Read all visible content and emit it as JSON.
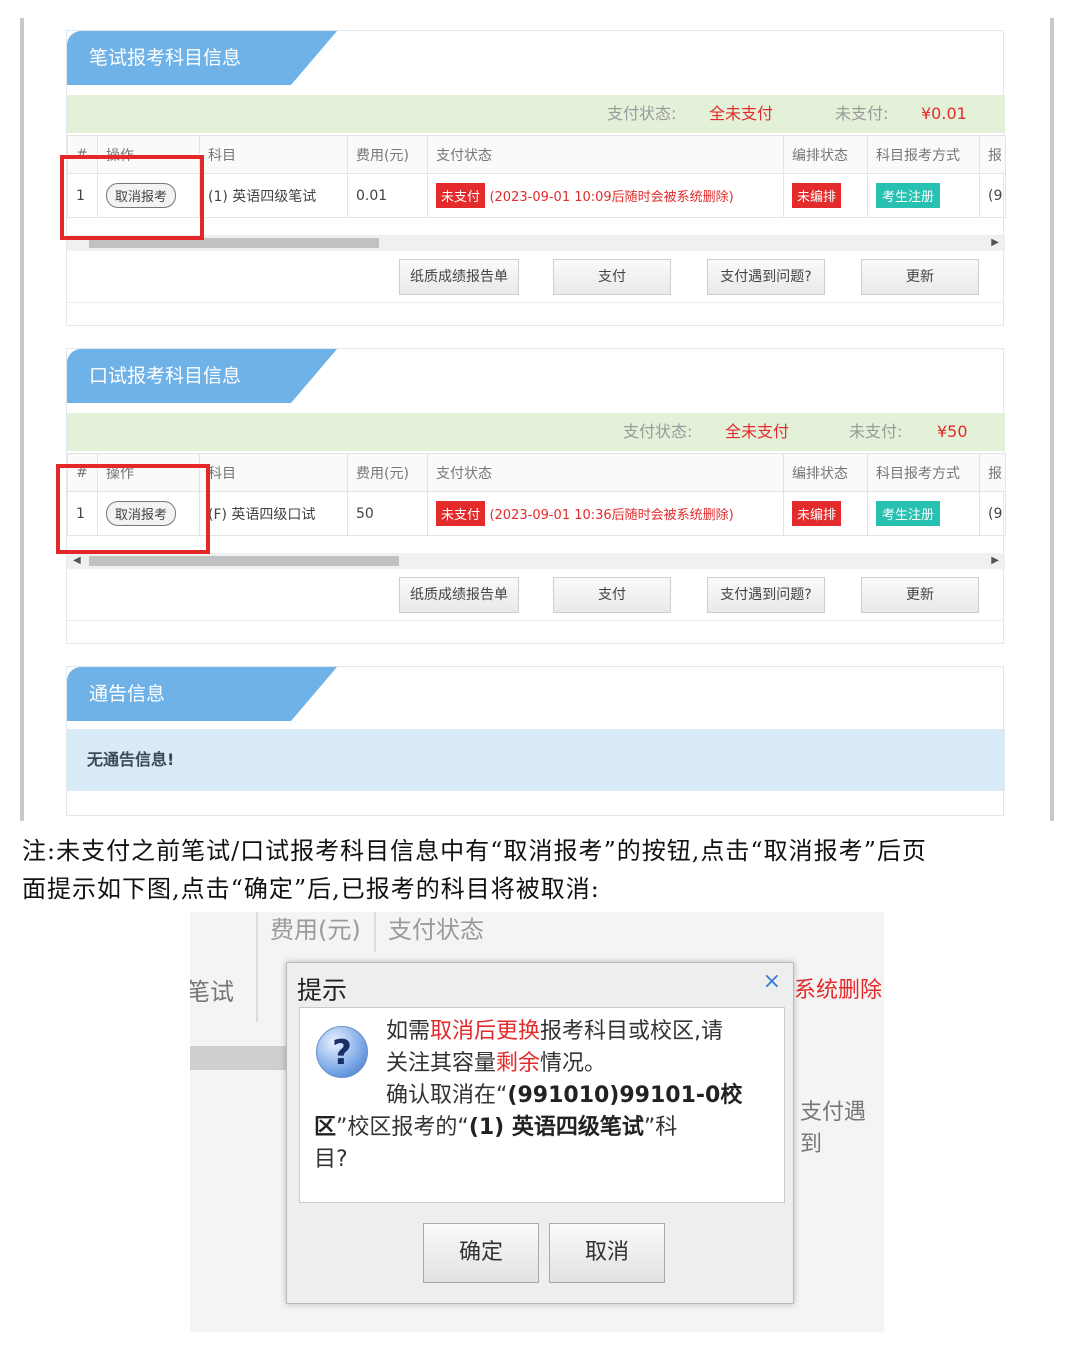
{
  "written_panel": {
    "title": "笔试报考科目信息",
    "status_label": "支付状态:",
    "status_value": "全未支付",
    "unpaid_label": "未支付:",
    "unpaid_value": "¥0.01",
    "headers": [
      "#",
      "操作",
      "科目",
      "费用(元)",
      "支付状态",
      "编排状态",
      "科目报考方式",
      "报"
    ],
    "row": {
      "index": "1",
      "action": "取消报考",
      "subject": "(1) 英语四级笔试",
      "fee": "0.01",
      "pay_tag": "未支付",
      "pay_note": "(2023-09-01 10:09后随时会被系统删除)",
      "arrange": "未编排",
      "method": "考生注册",
      "extra": "(9"
    },
    "buttons": [
      "纸质成绩报告单",
      "支付",
      "支付遇到问题?",
      "更新"
    ]
  },
  "oral_panel": {
    "title": "口试报考科目信息",
    "status_label": "支付状态:",
    "status_value": "全未支付",
    "unpaid_label": "未支付:",
    "unpaid_value": "¥50",
    "headers": [
      "#",
      "操作",
      "科目",
      "费用(元)",
      "支付状态",
      "编排状态",
      "科目报考方式",
      "报"
    ],
    "row": {
      "index": "1",
      "action": "取消报考",
      "subject": "(F) 英语四级口试",
      "fee": "50",
      "pay_tag": "未支付",
      "pay_note": "(2023-09-01 10:36后随时会被系统删除)",
      "arrange": "未编排",
      "method": "考生注册",
      "extra": "(9"
    },
    "buttons": [
      "纸质成绩报告单",
      "支付",
      "支付遇到问题?",
      "更新"
    ]
  },
  "notice_panel": {
    "title": "通告信息",
    "message": "无通告信息!"
  },
  "note": {
    "line1": "注:未支付之前笔试/口试报考科目信息中有“取消报考”的按钮,点击“取消报考”后页",
    "line2": "面提示如下图,点击“确定”后,已报考的科目将被取消:"
  },
  "dialog_shot": {
    "bg_header_fee": "费用(元)",
    "bg_header_status": "支付状态",
    "bg_subject": "笔试",
    "bg_delete": "系统删除",
    "bg_button": "支付遇到",
    "title": "提示",
    "close": "×",
    "icon": "question-icon",
    "line1_a": "如需",
    "line1_hl": "取消后更换",
    "line1_b": "报考科目或校区,请",
    "line2_a": "关注其容量",
    "line2_hl": "剩余",
    "line2_b": "情况。",
    "line3_a": "确认取消在“",
    "line3_b": "(991010)99101-0校",
    "line4_a": "区",
    "line4_b": "”校区报考的“",
    "line4_c": "(1) 英语四级笔试",
    "line4_d": "”科",
    "line5": "目?",
    "confirm": "确定",
    "cancel": "取消"
  },
  "colors": {
    "tab_blue": "#6fb2e8",
    "status_green": "#e3f1d9",
    "alert_red": "#e32b2b",
    "teal": "#28c0b0",
    "notice_blue": "#d8ebf6",
    "highlight_box": "#e42727"
  }
}
